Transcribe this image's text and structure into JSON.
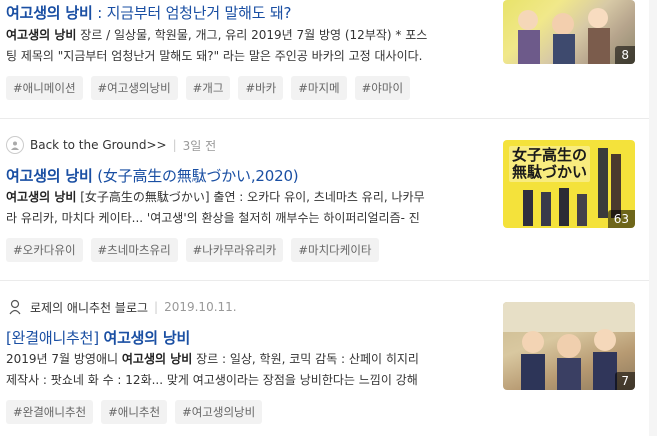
{
  "results": [
    {
      "title_bold": "여고생의 낭비",
      "title_rest": " : 지금부터 엄청난거 말해도 돼?",
      "desc_line1_bold": "여고생의 낭비",
      "desc_line1_rest": " 장르 / 일상물, 학원물, 개그, 유리 2019년 7월 방영 (12부작) * 포스",
      "desc_line2": "팅 제목의 \"지금부터 엄청난거 말해도 돼?\" 라는 말은 주인공 바카의 고정 대사이다.",
      "tags": [
        "#애니메이션",
        "#여고생의낭비",
        "#개그",
        "#바카",
        "#마지메",
        "#야마이"
      ],
      "image_count": "8"
    },
    {
      "source_name": "Back to the Ground>>",
      "date": "3일 전",
      "title_bold": "여고생의 낭비",
      "title_rest": " (女子高生の無駄づかい,2020)",
      "desc_line1_bold": "여고생의 낭비",
      "desc_line1_rest": " [女子高生の無駄づかい] 출연 : 오카다 유이, 츠네마츠 유리, 나카무",
      "desc_line2": "라 유리카, 마치다 케이타... '여고생'의 환상을 철저히 깨부수는 하이퍼리얼리즘- 진",
      "tags": [
        "#오카다유이",
        "#츠네마츠유리",
        "#나카무라유리카",
        "#마치다케이타"
      ],
      "image_count": "63",
      "thumb_text_line1": "女子高生の",
      "thumb_text_line2": "無駄づかい"
    },
    {
      "source_name": "로제의 애니추천 블로그",
      "date": "2019.10.11.",
      "title_prefix": "[완결애니추천] ",
      "title_bold": "여고생의 낭비",
      "desc_line1_pre": "2019년 7월 방영애니 ",
      "desc_line1_bold": "여고생의 낭비",
      "desc_line1_rest": " 장르 : 일상, 학원, 코믹 감독 : 산페이 히지리",
      "desc_line2": "제작사 : 팟쇼네 화 수 : 12화... 맞게 여고생이라는 장점을 낭비한다는 느낌이 강해",
      "tags": [
        "#완결애니추천",
        "#애니추천",
        "#여고생의낭비"
      ],
      "image_count": "7"
    }
  ],
  "colors": {
    "title": "#1a4fa3",
    "tag_bg": "#f2f2f2"
  }
}
